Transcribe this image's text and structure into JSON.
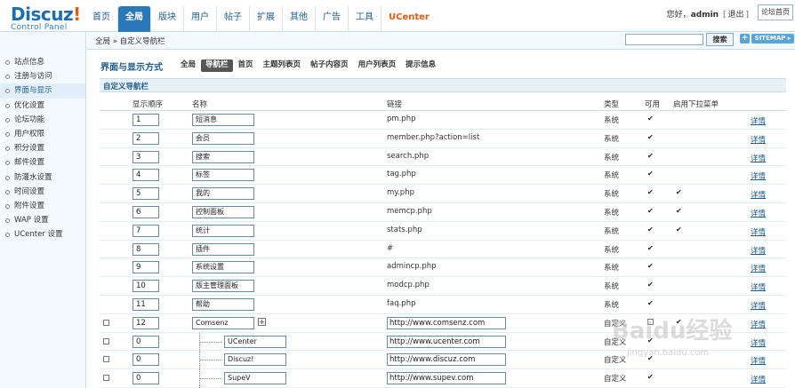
{
  "logo": {
    "main": "Discuz",
    "bang": "!",
    "sub": "Control Panel"
  },
  "topnav": {
    "tabs": [
      "首页",
      "全局",
      "版块",
      "用户",
      "帖子",
      "扩展",
      "其他",
      "广告",
      "工具",
      "UCenter"
    ],
    "active_index": 1
  },
  "user": {
    "greeting": "您好，",
    "name": "admin",
    "logout": "退出",
    "forum_home": "论坛首页"
  },
  "breadcrumb": {
    "text": "全局 » 自定义导航栏"
  },
  "search": {
    "value": "",
    "button": "搜索"
  },
  "sitemap": {
    "plus": "+",
    "label": "SITEMAP ▸"
  },
  "sidebar": {
    "items": [
      "站点信息",
      "注册与访问",
      "界面与显示",
      "优化设置",
      "论坛功能",
      "用户权限",
      "积分设置",
      "邮件设置",
      "防灌水设置",
      "时间设置",
      "附件设置",
      "WAP 设置",
      "UCenter 设置"
    ],
    "active_index": 2
  },
  "section": {
    "title": "界面与显示方式",
    "subtabs": [
      "全局",
      "导航栏",
      "首页",
      "主题列表页",
      "帖子内容页",
      "用户列表页",
      "提示信息"
    ],
    "active_subtab": 1,
    "block_title": "自定义导航栏"
  },
  "table": {
    "headers": {
      "order": "显示顺序",
      "name": "名称",
      "link": "链接",
      "type": "类型",
      "available": "可用",
      "dropdown": "启用下拉菜单"
    },
    "detail_label": "详情",
    "check_mark": "✔",
    "plus_mark": "+",
    "rows": [
      {
        "order": "1",
        "name": "短消息",
        "link": "pm.php",
        "type": "系统",
        "available": true,
        "dropdown": false,
        "custom": false,
        "child": false
      },
      {
        "order": "2",
        "name": "会员",
        "link": "member.php?action=list",
        "type": "系统",
        "available": true,
        "dropdown": false,
        "custom": false,
        "child": false
      },
      {
        "order": "3",
        "name": "搜索",
        "link": "search.php",
        "type": "系统",
        "available": true,
        "dropdown": false,
        "custom": false,
        "child": false
      },
      {
        "order": "4",
        "name": "标签",
        "link": "tag.php",
        "type": "系统",
        "available": true,
        "dropdown": false,
        "custom": false,
        "child": false
      },
      {
        "order": "5",
        "name": "我的",
        "link": "my.php",
        "type": "系统",
        "available": true,
        "dropdown": true,
        "custom": false,
        "child": false
      },
      {
        "order": "6",
        "name": "控制面板",
        "link": "memcp.php",
        "type": "系统",
        "available": true,
        "dropdown": true,
        "custom": false,
        "child": false
      },
      {
        "order": "7",
        "name": "统计",
        "link": "stats.php",
        "type": "系统",
        "available": true,
        "dropdown": true,
        "custom": false,
        "child": false
      },
      {
        "order": "8",
        "name": "插件",
        "link": "#",
        "type": "系统",
        "available": true,
        "dropdown": false,
        "custom": false,
        "child": false
      },
      {
        "order": "9",
        "name": "系统设置",
        "link": "admincp.php",
        "type": "系统",
        "available": true,
        "dropdown": false,
        "custom": false,
        "child": false
      },
      {
        "order": "10",
        "name": "版主管理面板",
        "link": "modcp.php",
        "type": "系统",
        "available": true,
        "dropdown": false,
        "custom": false,
        "child": false
      },
      {
        "order": "11",
        "name": "帮助",
        "link": "faq.php",
        "type": "系统",
        "available": true,
        "dropdown": false,
        "custom": false,
        "child": false
      },
      {
        "order": "12",
        "name": "Comsenz",
        "link": "http://www.comsenz.com",
        "type": "自定义",
        "available": false,
        "dropdown": true,
        "custom": true,
        "child": false
      },
      {
        "order": "0",
        "name": "UCenter",
        "link": "http://www.ucenter.com",
        "type": "自定义",
        "available": true,
        "dropdown": false,
        "custom": true,
        "child": true
      },
      {
        "order": "0",
        "name": "Discuz!",
        "link": "http://www.discuz.com",
        "type": "自定义",
        "available": true,
        "dropdown": false,
        "custom": true,
        "child": true
      },
      {
        "order": "0",
        "name": "SupeV",
        "link": "http://www.supev.com",
        "type": "自定义",
        "available": true,
        "dropdown": false,
        "custom": true,
        "child": true
      }
    ]
  },
  "watermark": {
    "text": "Baidu经验",
    "sub": "jingyan.baidu.com"
  }
}
